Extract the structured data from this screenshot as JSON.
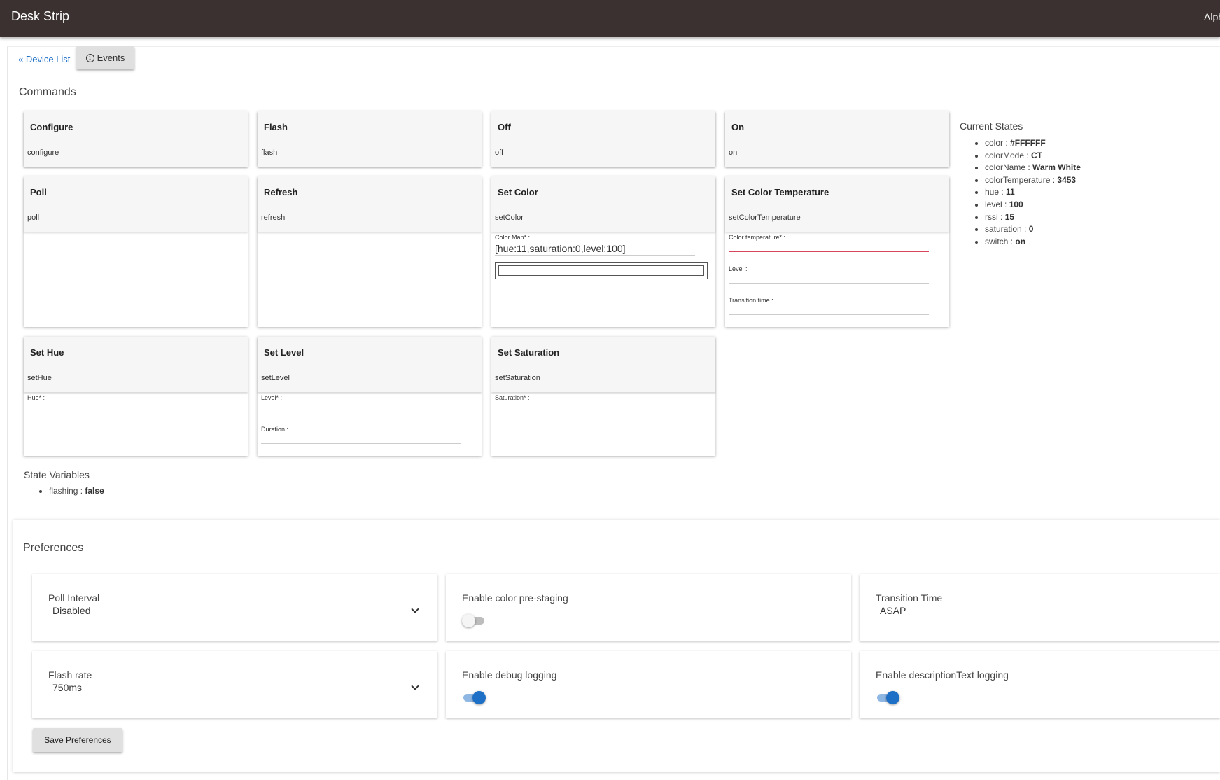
{
  "header": {
    "title": "Desk Strip",
    "right_text": "Alph"
  },
  "nav": {
    "back_label": "« Device List",
    "events_label": "Events"
  },
  "commands": {
    "title": "Commands",
    "configure": {
      "name": "Configure",
      "method": "configure"
    },
    "flash": {
      "name": "Flash",
      "method": "flash"
    },
    "off": {
      "name": "Off",
      "method": "off"
    },
    "on": {
      "name": "On",
      "method": "on"
    },
    "poll": {
      "name": "Poll",
      "method": "poll"
    },
    "refresh": {
      "name": "Refresh",
      "method": "refresh"
    },
    "set_color": {
      "name": "Set Color",
      "method": "setColor",
      "field_label": "Color Map* :",
      "field_value": "[hue:11,saturation:0,level:100]"
    },
    "set_color_temp": {
      "name": "Set Color Temperature",
      "method": "setColorTemperature",
      "f1_label": "Color temperature* :",
      "f2_label": "Level :",
      "f3_label": "Transition time :"
    },
    "set_hue": {
      "name": "Set Hue",
      "method": "setHue",
      "f1_label": "Hue* :"
    },
    "set_level": {
      "name": "Set Level",
      "method": "setLevel",
      "f1_label": "Level* :",
      "f2_label": "Duration :"
    },
    "set_saturation": {
      "name": "Set Saturation",
      "method": "setSaturation",
      "f1_label": "Saturation* :"
    }
  },
  "current_states": {
    "title": "Current States",
    "items": [
      {
        "key": "color",
        "value": "#FFFFFF"
      },
      {
        "key": "colorMode",
        "value": "CT"
      },
      {
        "key": "colorName",
        "value": "Warm White"
      },
      {
        "key": "colorTemperature",
        "value": "3453"
      },
      {
        "key": "hue",
        "value": "11"
      },
      {
        "key": "level",
        "value": "100"
      },
      {
        "key": "rssi",
        "value": "15"
      },
      {
        "key": "saturation",
        "value": "0"
      },
      {
        "key": "switch",
        "value": "on"
      }
    ]
  },
  "state_variables": {
    "title": "State Variables",
    "items": [
      {
        "key": "flashing",
        "value": "false"
      }
    ]
  },
  "preferences": {
    "title": "Preferences",
    "poll_interval": {
      "label": "Poll Interval",
      "value": "Disabled"
    },
    "color_prestaging": {
      "label": "Enable color pre-staging",
      "enabled": false
    },
    "transition_time": {
      "label": "Transition Time",
      "value": "ASAP"
    },
    "flash_rate": {
      "label": "Flash rate",
      "value": "750ms"
    },
    "debug_logging": {
      "label": "Enable debug logging",
      "enabled": true
    },
    "desc_logging": {
      "label": "Enable descriptionText logging",
      "enabled": true
    },
    "save_label": "Save Preferences"
  }
}
